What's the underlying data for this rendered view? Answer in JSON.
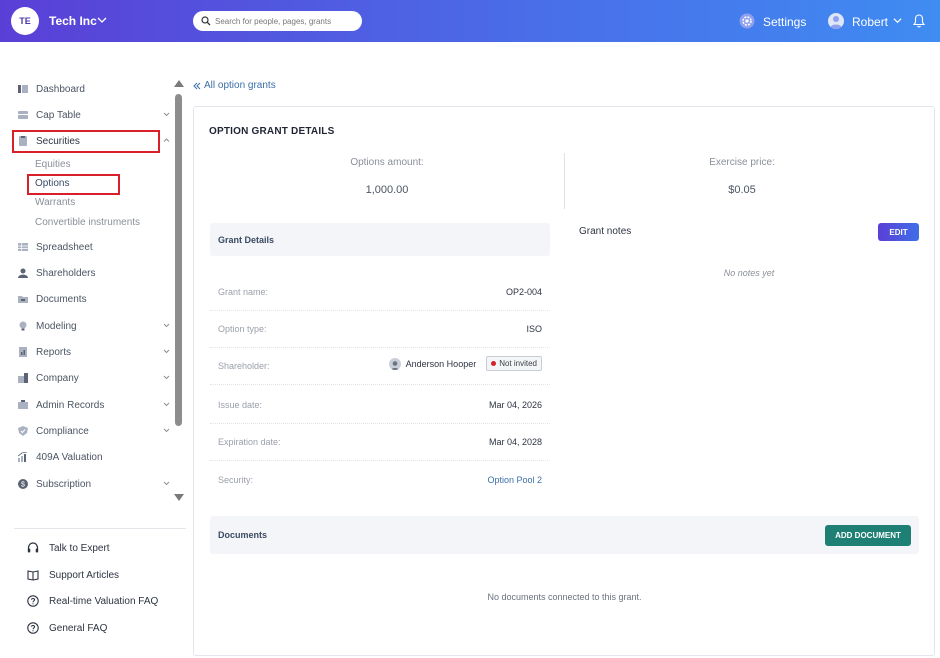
{
  "header": {
    "logo_initials": "TE",
    "company_name": "Tech Inc",
    "search_placeholder": "Search for people, pages, grants",
    "settings_label": "Settings",
    "user_name": "Robert"
  },
  "sidebar": {
    "items": [
      {
        "label": "Dashboard",
        "icon": "dashboard-icon"
      },
      {
        "label": "Cap Table",
        "icon": "cap-table-icon"
      },
      {
        "label": "Securities",
        "icon": "securities-icon"
      },
      {
        "label": "Spreadsheet",
        "icon": "spreadsheet-icon"
      },
      {
        "label": "Shareholders",
        "icon": "shareholders-icon"
      },
      {
        "label": "Documents",
        "icon": "documents-icon"
      },
      {
        "label": "Modeling",
        "icon": "modeling-icon"
      },
      {
        "label": "Reports",
        "icon": "reports-icon"
      },
      {
        "label": "Company",
        "icon": "company-icon"
      },
      {
        "label": "Admin Records",
        "icon": "admin-records-icon"
      },
      {
        "label": "Compliance",
        "icon": "compliance-icon"
      },
      {
        "label": "409A Valuation",
        "icon": "valuation-icon"
      },
      {
        "label": "Subscription",
        "icon": "subscription-icon"
      }
    ],
    "securities_sub": [
      "Equities",
      "Options",
      "Warrants",
      "Convertible instruments"
    ],
    "help": [
      {
        "label": "Talk to Expert",
        "icon": "headset-icon"
      },
      {
        "label": "Support Articles",
        "icon": "book-icon"
      },
      {
        "label": "Real-time Valuation FAQ",
        "icon": "question-icon"
      },
      {
        "label": "General FAQ",
        "icon": "question-icon"
      }
    ]
  },
  "main": {
    "back_link": "All option grants",
    "title": "OPTION GRANT DETAILS",
    "options_amount_label": "Options amount:",
    "options_amount_value": "1,000.00",
    "exercise_price_label": "Exercise price:",
    "exercise_price_value": "$0.05",
    "grant_details_title": "Grant Details",
    "details": {
      "grant_name_label": "Grant name:",
      "grant_name_value": "OP2-004",
      "option_type_label": "Option type:",
      "option_type_value": "ISO",
      "shareholder_label": "Shareholder:",
      "shareholder_name": "Anderson Hooper",
      "shareholder_badge": "Not invited",
      "issue_date_label": "Issue date:",
      "issue_date_value": "Mar 04, 2026",
      "expiration_date_label": "Expiration date:",
      "expiration_date_value": "Mar 04, 2028",
      "security_label": "Security:",
      "security_value": "Option Pool 2"
    },
    "grant_notes_title": "Grant notes",
    "edit_button": "EDIT",
    "no_notes": "No notes yet",
    "documents_title": "Documents",
    "add_document_button": "ADD DOCUMENT",
    "no_documents": "No documents connected to this grant."
  },
  "colors": {
    "header_gradient_start": "#5a3fd6",
    "header_gradient_end": "#3f8cf2",
    "highlight_red": "#d8202a",
    "link_blue": "#3b6fa8",
    "add_doc_green": "#1e7f74"
  }
}
